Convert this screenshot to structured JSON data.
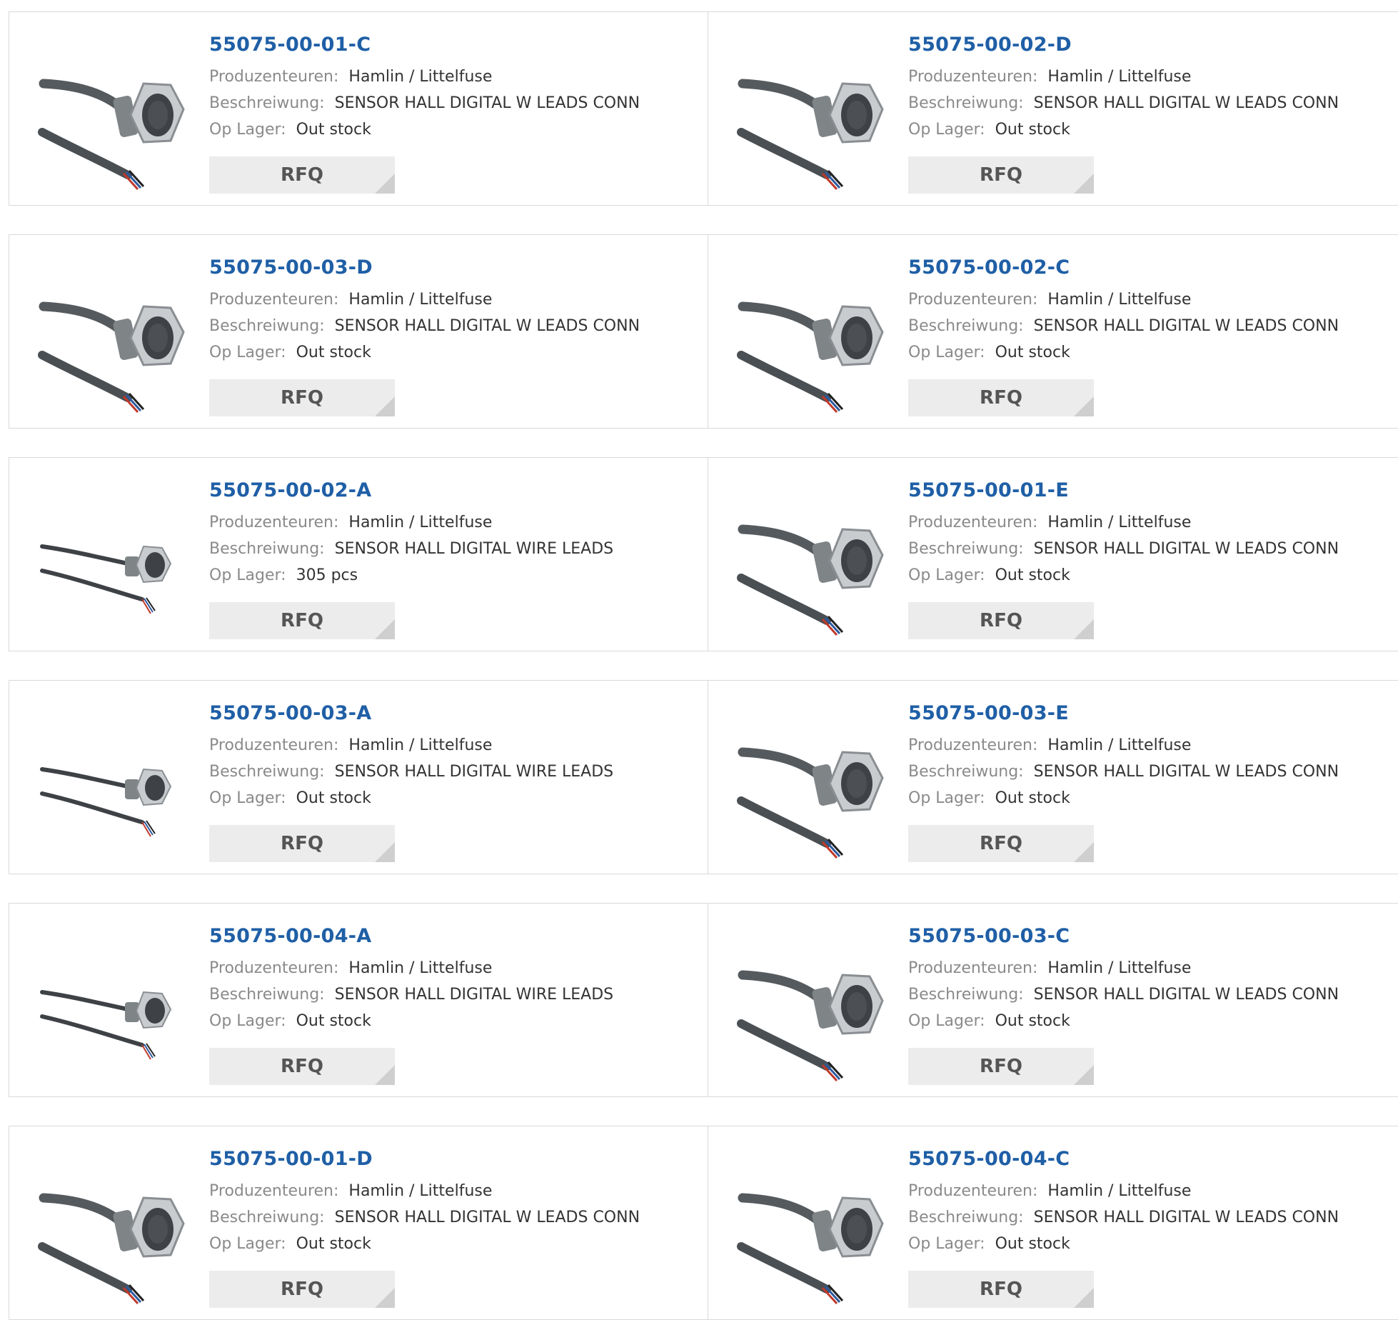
{
  "labels": {
    "manufacturer": "Produzenteuren:",
    "description": "Beschreiwung:",
    "stock": "Op Lager:",
    "rfq": "RFQ"
  },
  "colors": {
    "part_link": "#1f5fa6",
    "label": "#8a8a8a",
    "button_bg": "#ececec"
  },
  "products": [
    {
      "part": "55075-00-01-C",
      "manufacturer": "Hamlin / Littelfuse",
      "description": "SENSOR HALL DIGITAL W LEADS CONN",
      "stock": "Out stock",
      "image": "sensor-connector"
    },
    {
      "part": "55075-00-02-D",
      "manufacturer": "Hamlin / Littelfuse",
      "description": "SENSOR HALL DIGITAL W LEADS CONN",
      "stock": "Out stock",
      "image": "sensor-connector"
    },
    {
      "part": "55075-00-03-D",
      "manufacturer": "Hamlin / Littelfuse",
      "description": "SENSOR HALL DIGITAL W LEADS CONN",
      "stock": "Out stock",
      "image": "sensor-connector"
    },
    {
      "part": "55075-00-02-C",
      "manufacturer": "Hamlin / Littelfuse",
      "description": "SENSOR HALL DIGITAL W LEADS CONN",
      "stock": "Out stock",
      "image": "sensor-connector"
    },
    {
      "part": "55075-00-02-A",
      "manufacturer": "Hamlin / Littelfuse",
      "description": "SENSOR HALL DIGITAL WIRE LEADS",
      "stock": "305 pcs",
      "image": "sensor-wire"
    },
    {
      "part": "55075-00-01-E",
      "manufacturer": "Hamlin / Littelfuse",
      "description": "SENSOR HALL DIGITAL W LEADS CONN",
      "stock": "Out stock",
      "image": "sensor-connector"
    },
    {
      "part": "55075-00-03-A",
      "manufacturer": "Hamlin / Littelfuse",
      "description": "SENSOR HALL DIGITAL WIRE LEADS",
      "stock": "Out stock",
      "image": "sensor-wire"
    },
    {
      "part": "55075-00-03-E",
      "manufacturer": "Hamlin / Littelfuse",
      "description": "SENSOR HALL DIGITAL W LEADS CONN",
      "stock": "Out stock",
      "image": "sensor-connector"
    },
    {
      "part": "55075-00-04-A",
      "manufacturer": "Hamlin / Littelfuse",
      "description": "SENSOR HALL DIGITAL WIRE LEADS",
      "stock": "Out stock",
      "image": "sensor-wire"
    },
    {
      "part": "55075-00-03-C",
      "manufacturer": "Hamlin / Littelfuse",
      "description": "SENSOR HALL DIGITAL W LEADS CONN",
      "stock": "Out stock",
      "image": "sensor-connector"
    },
    {
      "part": "55075-00-01-D",
      "manufacturer": "Hamlin / Littelfuse",
      "description": "SENSOR HALL DIGITAL W LEADS CONN",
      "stock": "Out stock",
      "image": "sensor-connector"
    },
    {
      "part": "55075-00-04-C",
      "manufacturer": "Hamlin / Littelfuse",
      "description": "SENSOR HALL DIGITAL W LEADS CONN",
      "stock": "Out stock",
      "image": "sensor-connector"
    }
  ]
}
